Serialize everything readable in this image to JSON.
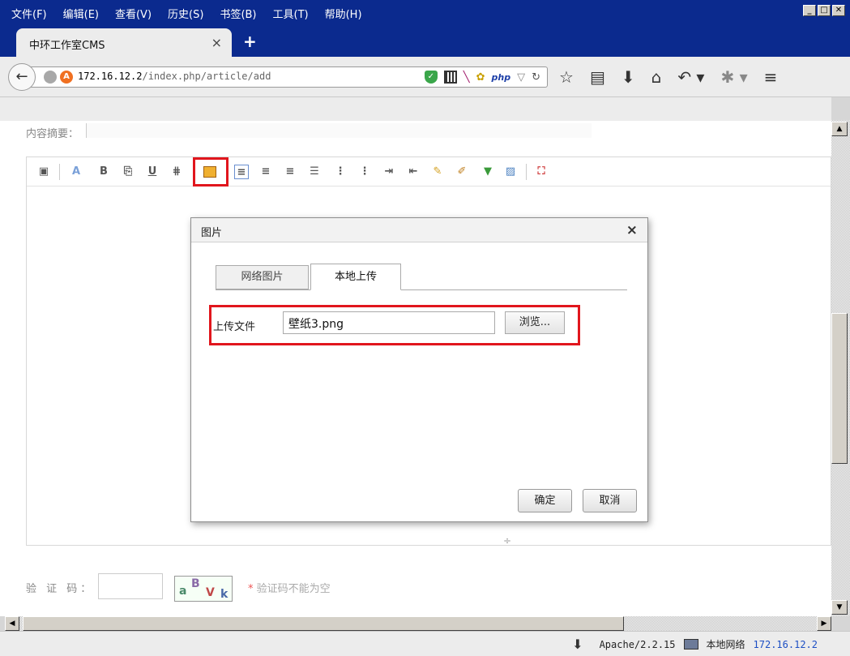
{
  "menu": [
    "文件(F)",
    "编辑(E)",
    "查看(V)",
    "历史(S)",
    "书签(B)",
    "工具(T)",
    "帮助(H)"
  ],
  "tab": {
    "title": "中环工作室CMS",
    "close": "×",
    "new": "+"
  },
  "url": {
    "host": "172.16.12.2",
    "path": "/index.php/article/add"
  },
  "php_label": "php",
  "form": {
    "summary_label": "内容摘要：",
    "captcha_label": "验 证 码：",
    "captcha_chars": [
      "a",
      "B",
      "V",
      "k"
    ],
    "captcha_error": "验证码不能为空",
    "captcha_star": "*"
  },
  "dialog": {
    "title": "图片",
    "close": "×",
    "tabs": [
      "网络图片",
      "本地上传"
    ],
    "active_tab": "本地上传",
    "upload_label": "上传文件",
    "file_value": "壁纸3.png",
    "browse_label": "浏览...",
    "ok_label": "确定",
    "cancel_label": "取消"
  },
  "status": {
    "server": "Apache/2.2.15",
    "network": "本地网络",
    "ip": "172.16.12.2"
  }
}
